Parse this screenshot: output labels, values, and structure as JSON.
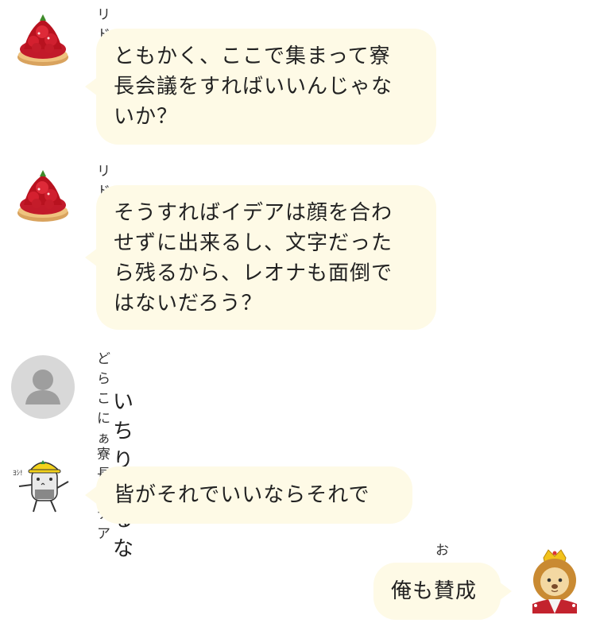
{
  "messages": [
    {
      "sender": "リドル",
      "avatar_icon": "strawberry-tart-icon",
      "text": "ともかく、ここで集まって寮\n長会議をすればいいんじゃな\nいか？",
      "side": "left"
    },
    {
      "sender": "リドル",
      "avatar_icon": "strawberry-tart-icon",
      "text": "そうすればイデアは顔を合わ\nせずに出来るし、文字だった\nら残るから、レオナも面倒で\nはないだろう？",
      "side": "left"
    },
    {
      "sender": "どらこにぁ",
      "avatar_icon": "default-user-icon",
      "text": "いちりあるな",
      "side": "left"
    },
    {
      "sender": "寮長イデア",
      "avatar_icon": "helmet-cat-icon",
      "avatar_caption": "ﾖｼ!",
      "text": "皆がそれでいいならそれで",
      "side": "left"
    },
    {
      "sender": "おじたん",
      "avatar_icon": "lion-king-icon",
      "text": "俺も賛成",
      "side": "right"
    }
  ],
  "colors": {
    "bubble": "#fefae6",
    "default_avatar_bg": "#d8d8d8",
    "default_avatar_fg": "#9e9e9e",
    "helmet": "#f3d21a"
  }
}
